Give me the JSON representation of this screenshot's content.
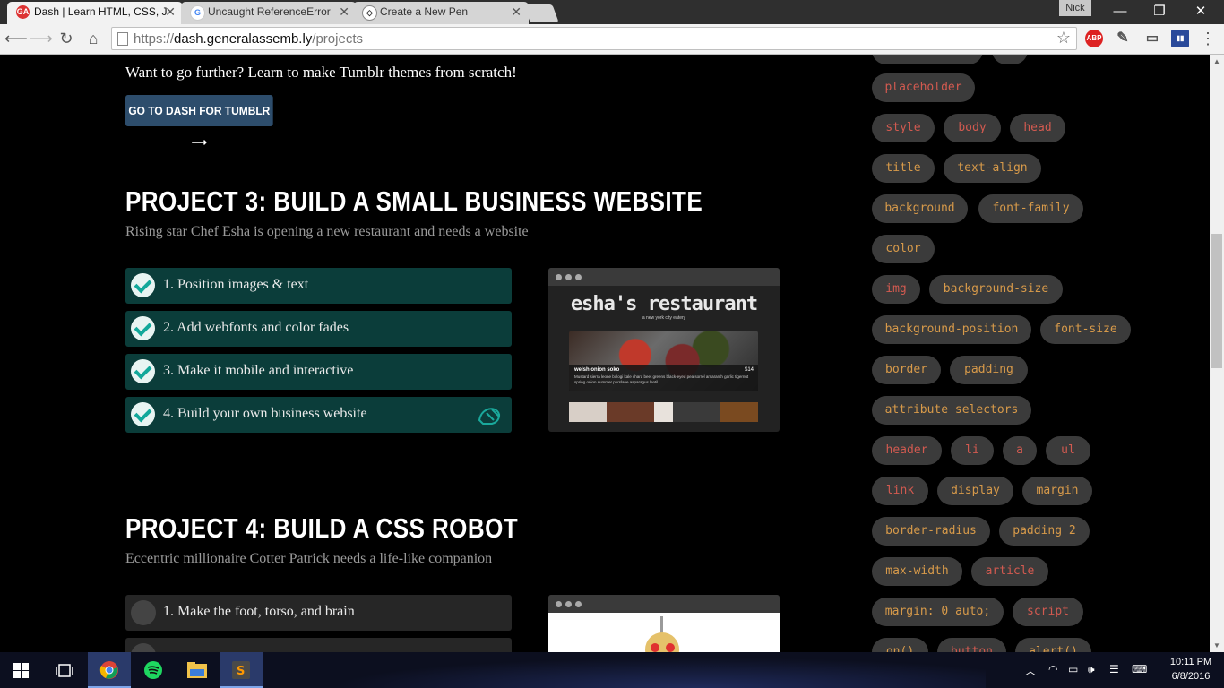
{
  "browser": {
    "tabs": [
      {
        "title": "Dash | Learn HTML, CSS, J",
        "favicon": "ga-logo-icon"
      },
      {
        "title": "Uncaught ReferenceError",
        "favicon": "google-icon"
      },
      {
        "title": "Create a New Pen",
        "favicon": "codepen-icon"
      }
    ],
    "profile_name": "Nick",
    "url_scheme": "https://",
    "url_host": "dash.generalassemb.ly",
    "url_path": "/projects",
    "extensions": [
      "abp-icon",
      "eyedropper-icon",
      "cast-icon",
      "stats-icon"
    ]
  },
  "page": {
    "further_text": "Want to go further? Learn to make Tumblr themes from scratch!",
    "tumblr_button": "GO TO DASH FOR TUMBLR ⟶",
    "project3": {
      "title": "PROJECT 3: BUILD A SMALL BUSINESS WEBSITE",
      "subtitle": "Rising star Chef Esha is opening a new restaurant and needs a website",
      "steps": [
        {
          "label": "1. Position images & text",
          "done": true
        },
        {
          "label": "2. Add webfonts and color fades",
          "done": true
        },
        {
          "label": "3. Make it mobile and interactive",
          "done": true
        },
        {
          "label": "4. Build your own business website",
          "done": true
        }
      ],
      "preview": {
        "title": "esha's restaurant",
        "subtitle": "a new york city eatery",
        "dish_name": "welsh onion soko",
        "dish_price": "$14",
        "dish_desc": "Mustard sierra leone bologi kale chard beet greens black-eyed pea sorrel amaranth garlic tigernut spring onion summer purslane asparagus lentil."
      }
    },
    "project4": {
      "title": "PROJECT 4: BUILD A CSS ROBOT",
      "subtitle": "Eccentric millionaire Cotter Patrick needs a life-like companion",
      "steps": [
        {
          "label": "1. Make the foot, torso, and brain",
          "done": false
        }
      ]
    }
  },
  "sidebar_tags": [
    {
      "label": "placeholder",
      "color": "red"
    },
    {
      "label": "style",
      "color": "red"
    },
    {
      "label": "body",
      "color": "red"
    },
    {
      "label": "head",
      "color": "red"
    },
    {
      "label": "title",
      "color": "orange"
    },
    {
      "label": "text-align",
      "color": "orange"
    },
    {
      "label": "background",
      "color": "orange"
    },
    {
      "label": "font-family",
      "color": "orange"
    },
    {
      "label": "color",
      "color": "orange"
    },
    {
      "label": "img",
      "color": "red"
    },
    {
      "label": "background-size",
      "color": "orange"
    },
    {
      "label": "background-position",
      "color": "orange"
    },
    {
      "label": "font-size",
      "color": "orange"
    },
    {
      "label": "border",
      "color": "orange"
    },
    {
      "label": "padding",
      "color": "orange"
    },
    {
      "label": "attribute selectors",
      "color": "orange"
    },
    {
      "label": "header",
      "color": "red"
    },
    {
      "label": "li",
      "color": "red"
    },
    {
      "label": "a",
      "color": "red"
    },
    {
      "label": "ul",
      "color": "red"
    },
    {
      "label": "link",
      "color": "red"
    },
    {
      "label": "display",
      "color": "orange"
    },
    {
      "label": "margin",
      "color": "orange"
    },
    {
      "label": "border-radius",
      "color": "orange"
    },
    {
      "label": "padding 2",
      "color": "orange"
    },
    {
      "label": "max-width",
      "color": "orange"
    },
    {
      "label": "article",
      "color": "red"
    },
    {
      "label": "margin: 0 auto;",
      "color": "orange"
    },
    {
      "label": "script",
      "color": "red"
    },
    {
      "label": "on()",
      "color": "orange"
    },
    {
      "label": "button",
      "color": "red"
    },
    {
      "label": "alert()",
      "color": "orange"
    }
  ],
  "taskbar": {
    "time": "10:11 PM",
    "date": "6/8/2016",
    "apps": [
      "chrome-icon",
      "spotify-icon",
      "file-explorer-icon",
      "sublime-text-icon"
    ]
  },
  "colors": {
    "tag_red": "#d25a50",
    "tag_orange": "#d79a4a",
    "step_done": "#0b3d3a",
    "tumblr_button": "#2d4d6c"
  }
}
